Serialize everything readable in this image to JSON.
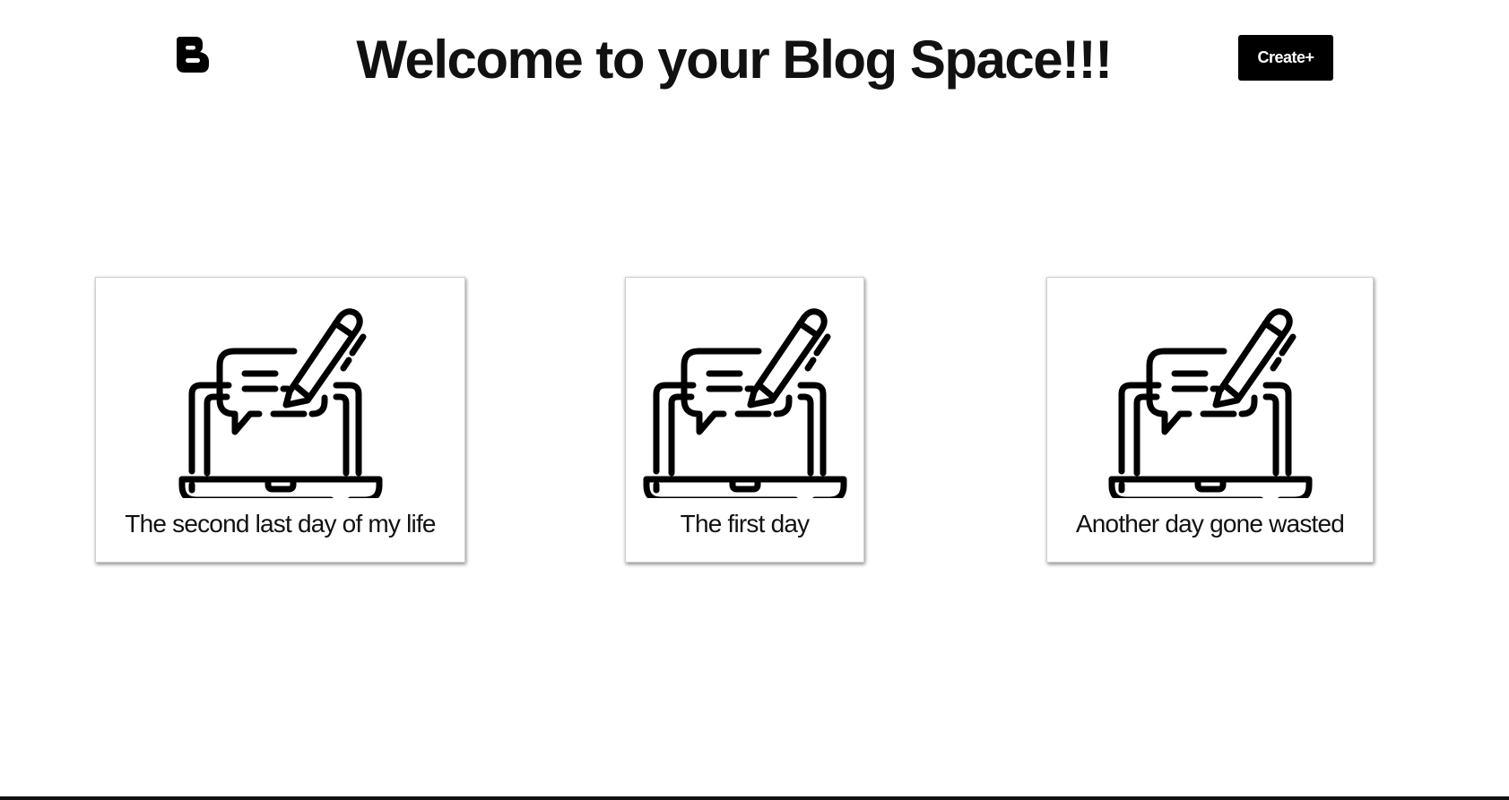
{
  "header": {
    "logo_icon": "blogger-logo-icon",
    "title": "Welcome to your Blog Space!!!",
    "create_label": "Create+"
  },
  "posts": [
    {
      "title": "The second last day of my life",
      "icon": "laptop-chat-pencil-icon"
    },
    {
      "title": "The first day",
      "icon": "laptop-chat-pencil-icon"
    },
    {
      "title": "Another day gone wasted",
      "icon": "laptop-chat-pencil-icon"
    }
  ],
  "colors": {
    "background": "#ffffff",
    "text": "#111111",
    "button_background": "#000000",
    "button_text": "#ffffff"
  }
}
